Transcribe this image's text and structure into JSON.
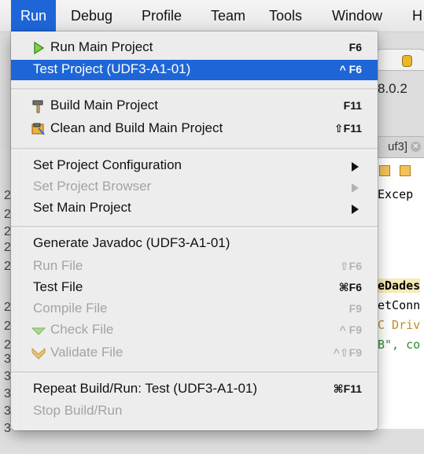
{
  "menubar": {
    "items": [
      "Run",
      "Debug",
      "Profile",
      "Team",
      "Tools",
      "Window",
      "H"
    ]
  },
  "run_menu": {
    "items": [
      {
        "label": "Run Main Project",
        "shortcut": "F6",
        "icon": "play-triangle-icon",
        "enabled": true,
        "highlighted": false
      },
      {
        "label": "Test Project (UDF3-A1-01)",
        "shortcut": "^ F6",
        "enabled": true,
        "highlighted": true
      },
      {
        "label": "Build Main Project",
        "shortcut": "F11",
        "icon": "hammer-icon",
        "enabled": true
      },
      {
        "label": "Clean and Build Main Project",
        "shortcut": "⇧F11",
        "icon": "broom-hammer-icon",
        "enabled": true
      },
      {
        "label": "Set Project Configuration",
        "submenu": true,
        "enabled": true
      },
      {
        "label": "Set Project Browser",
        "submenu": true,
        "enabled": false
      },
      {
        "label": "Set Main Project",
        "submenu": true,
        "enabled": true
      },
      {
        "label": "Generate Javadoc (UDF3-A1-01)",
        "enabled": true
      },
      {
        "label": "Run File",
        "shortcut": "⇧F6",
        "enabled": false
      },
      {
        "label": "Test File",
        "shortcut": "⌘F6",
        "enabled": true
      },
      {
        "label": "Compile File",
        "shortcut": "F9",
        "enabled": false
      },
      {
        "label": "Check File",
        "shortcut": "^ F9",
        "icon": "check-chevron-icon",
        "enabled": false
      },
      {
        "label": "Validate File",
        "shortcut": "^⇧F9",
        "icon": "validate-chevron-icon",
        "enabled": false
      },
      {
        "label": "Repeat Build/Run: Test (UDF3-A1-01)",
        "shortcut": "⌘F11",
        "enabled": true
      },
      {
        "label": "Stop Build/Run",
        "enabled": false
      }
    ]
  },
  "background": {
    "version_text": "8.0.2",
    "tab_label": "uf3]",
    "code_lines": [
      "Excep",
      "eDades",
      "etConn",
      "C Driv",
      "B\", co"
    ],
    "line_numbers": [
      "2",
      "2",
      "2",
      "2",
      "2",
      "2",
      "2",
      "2",
      "3",
      "3",
      "3",
      "3",
      "3"
    ],
    "colors": {
      "menu_highlight": "#1e66d8",
      "code_keyword": "#000000",
      "code_string": "#c08f1d",
      "code_green": "#2d8b2d"
    }
  }
}
